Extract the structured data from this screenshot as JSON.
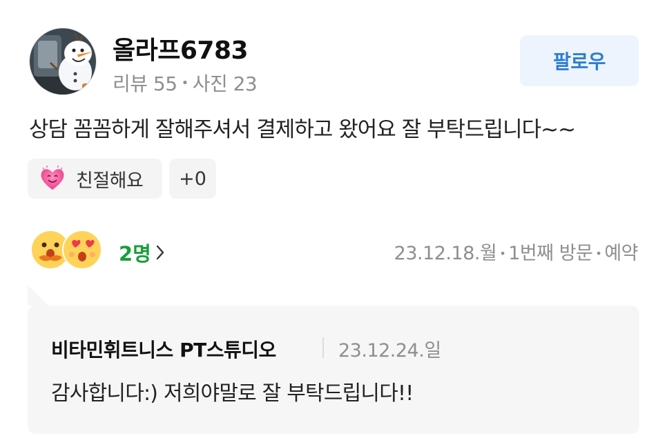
{
  "review": {
    "username": "올라프6783",
    "stats": {
      "reviews": "리뷰 55",
      "photos": "사진 23"
    },
    "follow_label": "팔로우",
    "body": "상담 꼼꼼하게 잘해주셔서 결제하고 왔어요 잘 부탁드립니다~~",
    "keyword_chip": "친절해요",
    "extra_chip": "+0",
    "reaction_count": "2명",
    "visit": {
      "date": "23.12.18.월",
      "count": "1번째 방문",
      "type": "예약"
    }
  },
  "owner_reply": {
    "name": "비타민휘트니스 PT스튜디오",
    "date": "23.12.24.일",
    "text": "감사합니다:) 저희야말로 잘 부탁드립니다!!"
  },
  "icons": {
    "avatar": "olaf-avatar-photo",
    "keyword": "smiling-heart-icon",
    "reactions": [
      "mustache-face-icon",
      "heart-eyes-face-icon"
    ],
    "chevron": "chevron-right-icon"
  },
  "colors": {
    "follow_text": "#2d7dd2",
    "follow_bg": "#edf4fd",
    "reaction_count": "#1a9e3a",
    "muted_text": "#8e8e8e",
    "reply_bg": "#f6f6f6"
  }
}
